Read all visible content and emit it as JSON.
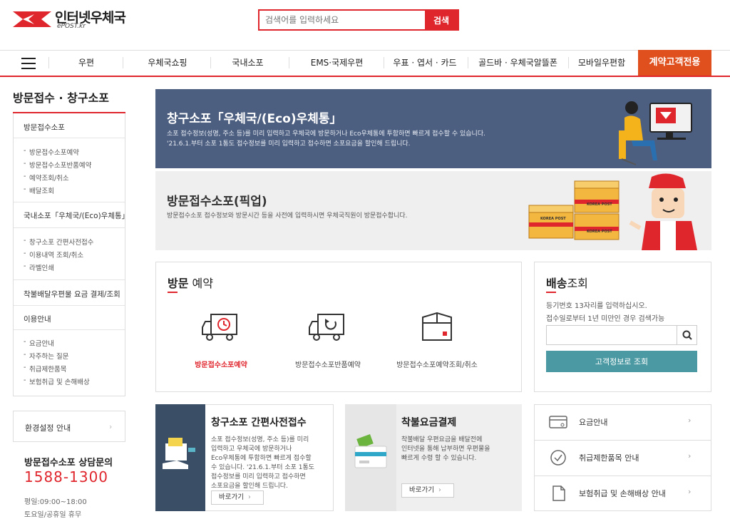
{
  "header": {
    "logo_title": "인터넷우체국",
    "logo_sub": "ePOST.kr",
    "search_placeholder": "검색어를 입력하세요",
    "search_button": "검색"
  },
  "gnb": {
    "items": [
      "우편",
      "우체국쇼핑",
      "국내소포",
      "EMS·국제우편",
      "우표 · 엽서 · 카드",
      "골드바 · 우체국알뜰폰",
      "모바일우편함"
    ],
    "special": "계약고객전용"
  },
  "lnb": {
    "title": "방문접수 · 창구소포",
    "sections": [
      {
        "label": "방문접수소포",
        "items": [
          "방문접수소포예약",
          "방문접수소포반품예약",
          "예약조회/취소",
          "배달조회"
        ]
      },
      {
        "label": "국내소포「우체국/(Eco)우체통」",
        "items": [
          "창구소포 간편사전접수",
          "이용내역 조회/취소",
          "라벨인쇄"
        ]
      },
      {
        "label": "착불배달우편물 요금 결제/조회",
        "items": []
      },
      {
        "label": "이용안내",
        "items": [
          "요금안내",
          "자주하는 질문",
          "취급제한품목",
          "보험취급 및 손해배상"
        ]
      }
    ],
    "env_settings": "환경설정 안내"
  },
  "cs": {
    "title": "방문접수소포 상담문의",
    "phone": "1588-1300",
    "hours": "평일:09:00~18:00",
    "holiday": "토요일/공휴일 휴무"
  },
  "banners": {
    "window": {
      "title": "창구소포「우체국/(Eco)우체통」",
      "desc1": "소포 접수정보(성명, 주소 등)를 미리 입력하고 우체국에 방문하거나 Eco우체통에 투함하면 빠르게 접수할 수 있습니다.",
      "desc2": "'21.6.1.부터 소포 1통도 접수정보를 미리 입력하고 접수하면 소포요금을 할인해 드립니다."
    },
    "pickup": {
      "title": "방문접수소포(픽업)",
      "desc": "방문접수소포 접수정보와 방문시간 등을 사전에 입력하시면 우체국직원이 방문접수합니다.",
      "box_label": "KOREA POST"
    }
  },
  "visit": {
    "title_bold": "방문",
    "title_rest": " 예약",
    "items": [
      "방문접수소포예약",
      "방문접수소포반품예약",
      "방문접수소포예약조회/취소"
    ],
    "active_color": "#e0262d"
  },
  "delivery": {
    "title_bold": "배송",
    "title_rest": "조회",
    "desc1": "등기번호 13자리를 입력하십시오.",
    "desc2": "접수일로부터 1년 미만인 경우 검색가능",
    "button": "고객정보로 조회"
  },
  "cards": {
    "prereg": {
      "title": "창구소포 간편사전접수",
      "lines": [
        "소포 접수정보(성명, 주소 등)를 미리",
        "입력하고 우체국에 방문하거나",
        "Eco우체통에 투함하면 빠르게 접수할",
        "수 있습니다. '21.6.1.부터 소포 1통도",
        "접수정보를 미리 입력하고 접수하면",
        "소포요금을 할인해 드립니다."
      ],
      "button": "바로가기"
    },
    "cod": {
      "title": "착불요금결제",
      "lines": [
        "착불배달 우편요금을 배달전에",
        "인터넷을 통해 납부하면 우편물을",
        "빠르게 수령 할 수 있습니다."
      ],
      "button": "바로가기"
    }
  },
  "quick": {
    "items": [
      "요금안내",
      "취급제한품목 안내",
      "보험취급 및 손해배상 안내"
    ]
  }
}
